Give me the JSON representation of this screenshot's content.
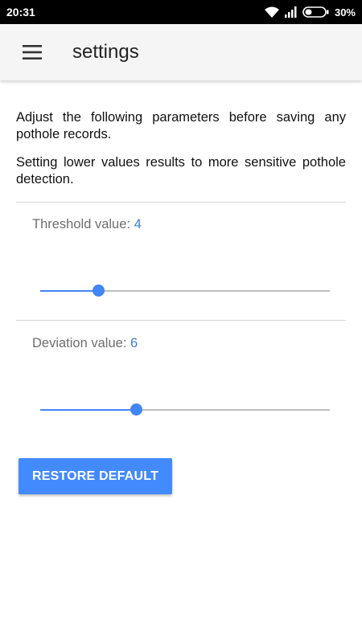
{
  "status_bar": {
    "time": "20:31",
    "battery_percent": "30%",
    "icons": [
      "wifi-icon",
      "signal-icon",
      "battery-icon"
    ]
  },
  "app_bar": {
    "menu_icon": "hamburger-menu-icon",
    "title": "settings"
  },
  "intro": {
    "paragraph_1": "Adjust the following parameters before saving any pothole records.",
    "paragraph_2": "Setting lower values results to more sensitive pothole detection."
  },
  "threshold": {
    "label": "Threshold value: ",
    "value": "4",
    "level": 0.2
  },
  "deviation": {
    "label": "Deviation value: ",
    "value": "6",
    "level": 0.333
  },
  "restore_button_label": "RESTORE DEFAULT",
  "colors": {
    "accent": "#4285f4",
    "value_text": "#3f7bdc",
    "button": "#448aff",
    "status_bar": "#000000",
    "app_bar": "#f5f5f5"
  }
}
